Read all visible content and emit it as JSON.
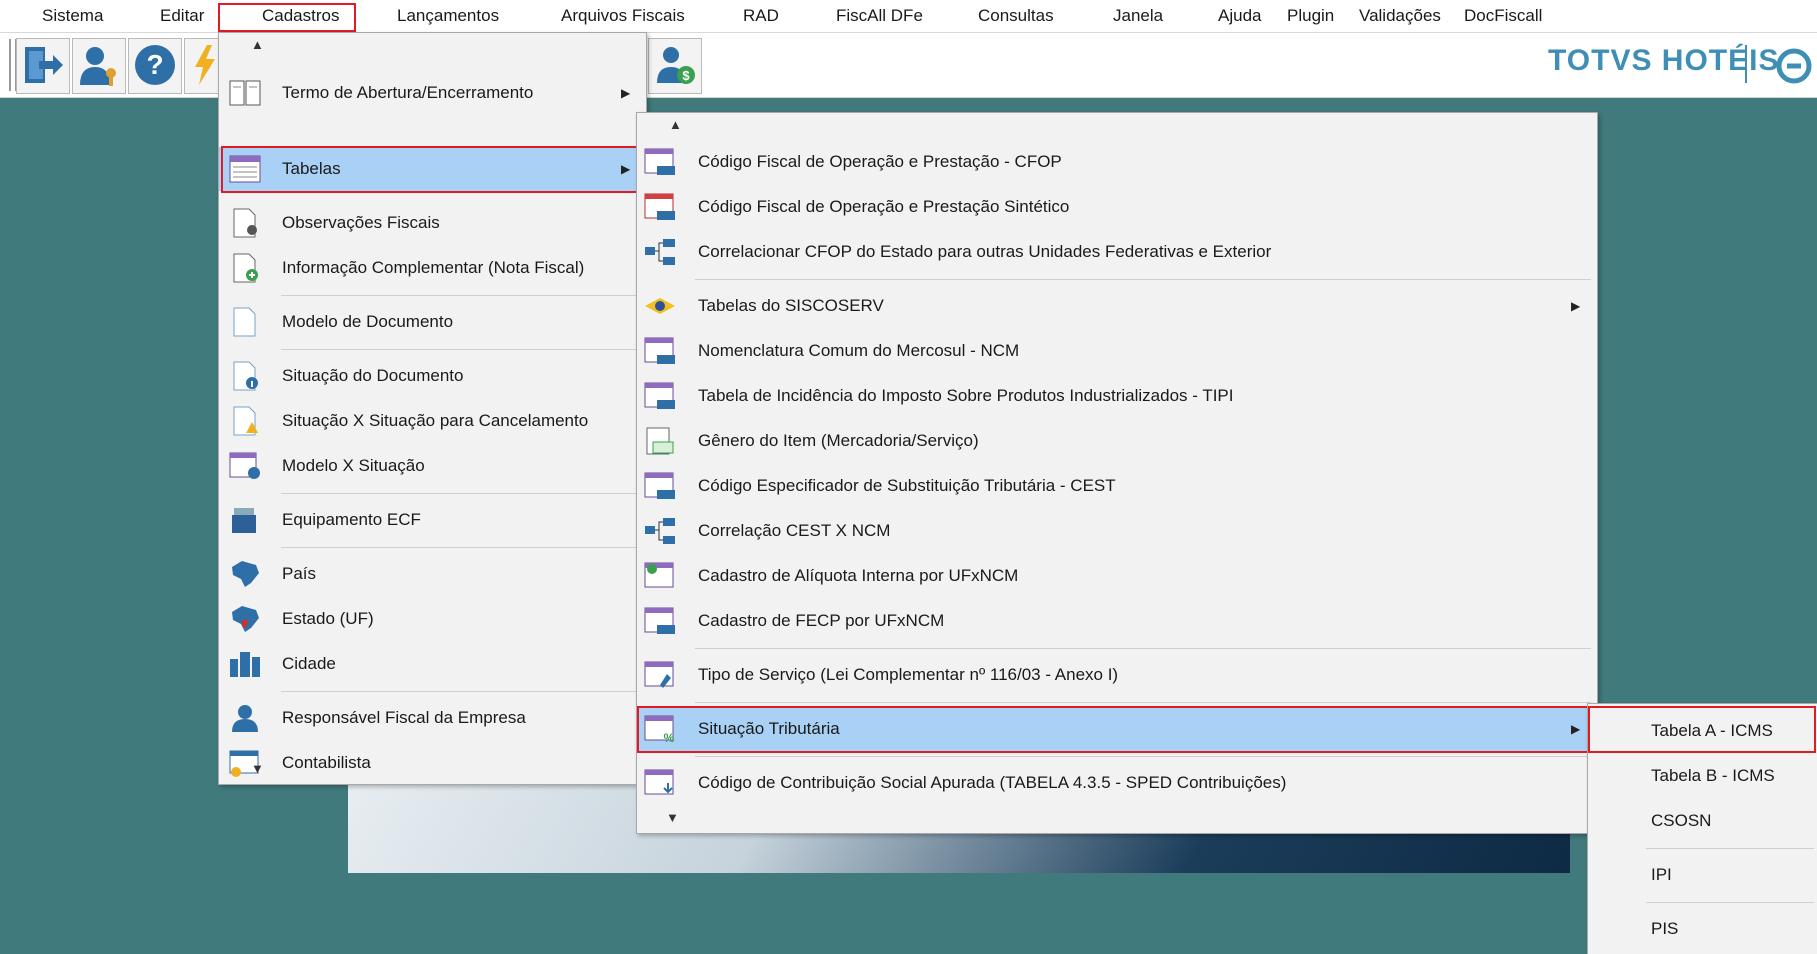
{
  "menubar": {
    "items": [
      "Sistema",
      "Editar",
      "Cadastros",
      "Lançamentos",
      "Arquivos Fiscais",
      "RAD",
      "FiscAll DFe",
      "Consultas",
      "Janela",
      "Ajuda",
      "Plugin",
      "Validações",
      "DocFiscall"
    ]
  },
  "brand": {
    "text": "TOTVS HOTÉIS"
  },
  "menu_cadastros": {
    "scroll_up": "▲",
    "scroll_down": "▼",
    "items": [
      {
        "label": "Termo de Abertura/Encerramento",
        "icon": "book-icon",
        "submenu": true
      },
      {
        "label": "Tabelas",
        "icon": "table-icon",
        "submenu": true,
        "highlighted": true
      },
      {
        "label": "Observações Fiscais",
        "icon": "doc-search-icon"
      },
      {
        "label": "Informação Complementar (Nota Fiscal)",
        "icon": "doc-add-icon"
      },
      {
        "label": "Modelo de Documento",
        "icon": "blank-doc-icon"
      },
      {
        "label": "Situação do Documento",
        "icon": "doc-info-icon"
      },
      {
        "label": "Situação X Situação para Cancelamento",
        "icon": "doc-warning-icon"
      },
      {
        "label": "Modelo X Situação",
        "icon": "table-info-icon"
      },
      {
        "label": "Equipamento ECF",
        "icon": "ecf-printer-icon"
      },
      {
        "label": "País",
        "icon": "country-map-icon"
      },
      {
        "label": "Estado (UF)",
        "icon": "state-map-icon"
      },
      {
        "label": "Cidade",
        "icon": "city-buildings-icon"
      },
      {
        "label": "Responsável Fiscal da Empresa",
        "icon": "user-icon"
      },
      {
        "label": "Contabilista",
        "icon": "accountant-icon"
      }
    ]
  },
  "menu_tabelas": {
    "scroll_up": "▲",
    "scroll_down": "▼",
    "items": [
      {
        "label": "Código Fiscal de Operação e Prestação - CFOP",
        "icon": "cfop-table-icon"
      },
      {
        "label": "Código Fiscal de Operação e Prestação Sintético",
        "icon": "cfop-table-red-icon"
      },
      {
        "label": "Correlacionar CFOP do Estado para outras Unidades Federativas e Exterior",
        "icon": "correlation-icon"
      },
      {
        "label": "Tabelas do SISCOSERV",
        "icon": "brazil-flag-icon",
        "submenu": true
      },
      {
        "label": "Nomenclatura Comum do Mercosul  - NCM",
        "icon": "ncm-table-icon"
      },
      {
        "label": "Tabela de Incidência do Imposto Sobre Produtos Industrializados - TIPI",
        "icon": "tipi-table-icon"
      },
      {
        "label": "Gênero do Item (Mercadoria/Serviço)",
        "icon": "money-doc-icon"
      },
      {
        "label": "Código Especificador de Substituição Tributária - CEST",
        "icon": "cest-table-icon"
      },
      {
        "label": "Correlação CEST X NCM",
        "icon": "correlation-icon"
      },
      {
        "label": "Cadastro de Alíquota Interna por UFxNCM",
        "icon": "aliquota-table-icon"
      },
      {
        "label": "Cadastro de FECP por UFxNCM",
        "icon": "fecp-table-icon"
      },
      {
        "label": "Tipo de Serviço (Lei Complementar nº 116/03 - Anexo I)",
        "icon": "service-table-icon"
      },
      {
        "label": "Situação Tributária",
        "icon": "tax-table-icon",
        "submenu": true,
        "highlighted": true
      },
      {
        "label": "Código de Contribuição Social Apurada (TABELA 4.3.5 - SPED Contribuições)",
        "icon": "download-table-icon"
      }
    ]
  },
  "menu_situacao": {
    "items": [
      {
        "label": "Tabela A - ICMS"
      },
      {
        "label": "Tabela B - ICMS"
      },
      {
        "label": "CSOSN"
      },
      {
        "label": "IPI"
      },
      {
        "label": "PIS"
      }
    ]
  }
}
